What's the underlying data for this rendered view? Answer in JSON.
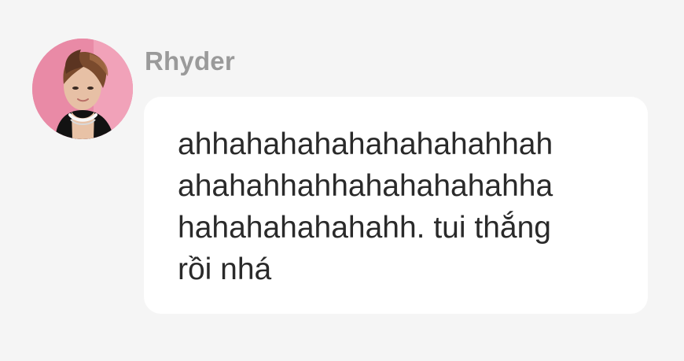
{
  "message": {
    "sender_name": "Rhyder",
    "text": "ahhahahahahahahahahhah\nahahahhahhahahahahahha\nhahahahahahahh. tui thắng\nrồi nhá",
    "avatar": "user-avatar-photo"
  },
  "colors": {
    "background": "#f5f5f5",
    "bubble": "#ffffff",
    "sender_name": "#9a9a9a",
    "message_text": "#2a2a2a",
    "avatar_background": "#e98aa6"
  }
}
